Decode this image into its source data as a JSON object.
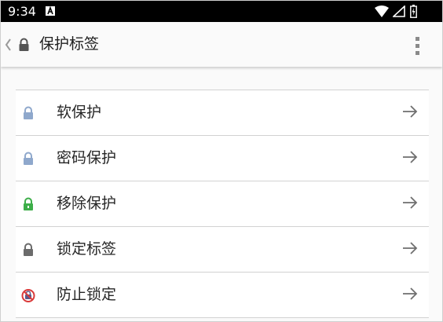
{
  "status_bar": {
    "time": "9:34",
    "notification_icon": "a-badge-icon",
    "icons": [
      "wifi-icon",
      "signal-icon",
      "battery-icon"
    ]
  },
  "app_bar": {
    "title": "保护标签",
    "icons": [
      "chevron-left-icon",
      "lock-icon",
      "overflow-menu-icon"
    ]
  },
  "items": [
    {
      "label": "软保护",
      "icon": "lock-icon",
      "icon_color": "#8fa8cc"
    },
    {
      "label": "密码保护",
      "icon": "lock-icon",
      "icon_color": "#8fa8cc"
    },
    {
      "label": "移除保护",
      "icon": "lock-open-icon",
      "icon_color": "#3dae49"
    },
    {
      "label": "锁定标签",
      "icon": "lock-icon",
      "icon_color": "#6b6b6b"
    },
    {
      "label": "防止锁定",
      "icon": "no-lock-icon",
      "icon_color": "#d93a3a"
    }
  ],
  "colors": {
    "status_bar": "#000000",
    "app_bar": "#fafafa",
    "divider": "#d2d2d2",
    "arrow": "#6f6f6f"
  }
}
